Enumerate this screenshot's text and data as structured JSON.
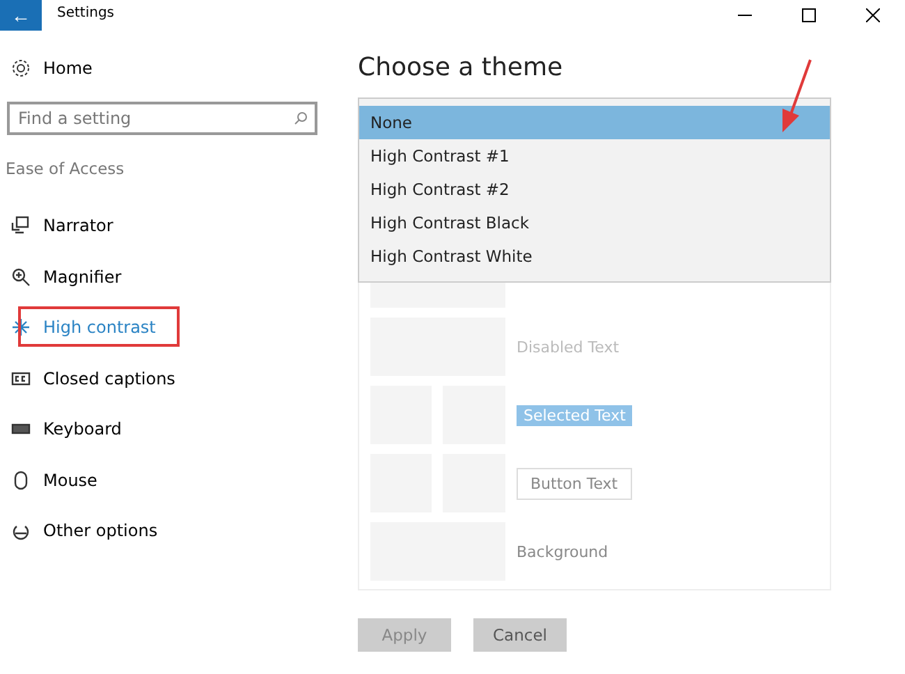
{
  "window": {
    "title": "Settings",
    "back": "←"
  },
  "sidebar": {
    "home": "Home",
    "search": {
      "placeholder": "Find a setting"
    },
    "section": "Ease of Access",
    "items": [
      {
        "label": "Narrator",
        "selected": false
      },
      {
        "label": "Magnifier",
        "selected": false
      },
      {
        "label": "High contrast",
        "selected": true
      },
      {
        "label": "Closed captions",
        "selected": false
      },
      {
        "label": "Keyboard",
        "selected": false
      },
      {
        "label": "Mouse",
        "selected": false
      },
      {
        "label": "Other options",
        "selected": false
      }
    ]
  },
  "main": {
    "title": "Choose a theme",
    "theme_options": [
      {
        "label": "None",
        "selected": true
      },
      {
        "label": "High Contrast #1",
        "selected": false
      },
      {
        "label": "High Contrast #2",
        "selected": false
      },
      {
        "label": "High Contrast Black",
        "selected": false
      },
      {
        "label": "High Contrast White",
        "selected": false
      }
    ],
    "preview_rows": [
      {
        "kind": "blank"
      },
      {
        "kind": "disabled",
        "label": "Disabled Text"
      },
      {
        "kind": "selected",
        "label": "Selected Text"
      },
      {
        "kind": "button",
        "label": "Button Text"
      },
      {
        "kind": "background",
        "label": "Background"
      }
    ],
    "buttons": [
      {
        "label": "Apply",
        "disabled": true
      },
      {
        "label": "Cancel",
        "disabled": false
      }
    ]
  }
}
